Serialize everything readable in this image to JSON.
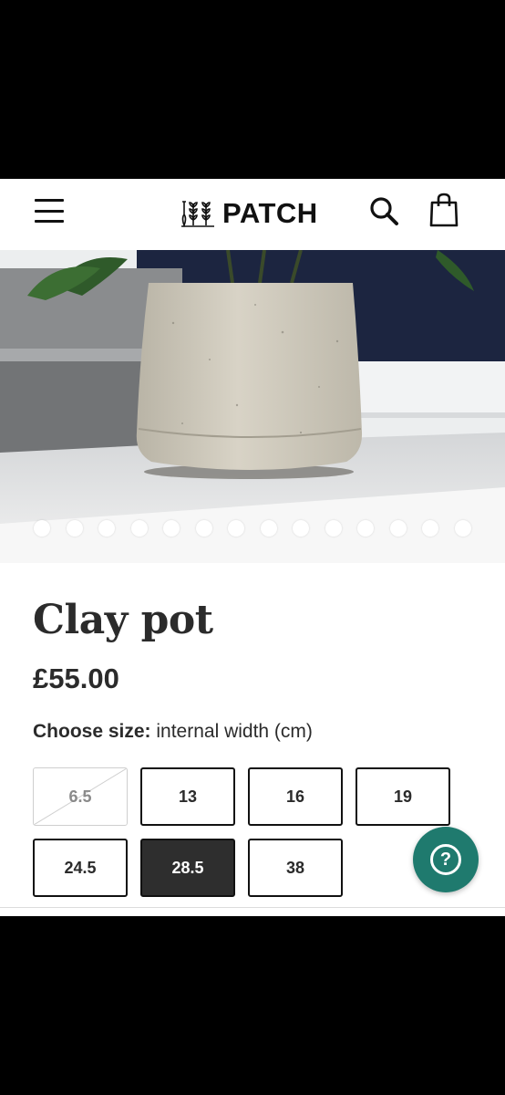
{
  "header": {
    "brand": "PATCH",
    "menu_icon": "hamburger-menu-icon",
    "search_icon": "search-icon",
    "bag_icon": "shopping-bag-icon"
  },
  "gallery": {
    "image": "concrete-plant-pot-photo",
    "slide_count": 14
  },
  "product": {
    "title": "Clay pot",
    "price": "£55.00"
  },
  "size_selector": {
    "label_strong": "Choose size:",
    "label_rest": " internal width (cm)",
    "options": [
      {
        "label": "6.5",
        "state": "unavailable"
      },
      {
        "label": "13",
        "state": "available"
      },
      {
        "label": "16",
        "state": "available"
      },
      {
        "label": "19",
        "state": "available"
      },
      {
        "label": "24.5",
        "state": "available"
      },
      {
        "label": "28.5",
        "state": "selected"
      },
      {
        "label": "38",
        "state": "available"
      }
    ]
  },
  "help": {
    "icon": "question-mark-icon",
    "symbol": "?"
  },
  "colors": {
    "accent": "#1f7a6e",
    "text": "#2b2b2b",
    "selected": "#2e2e2e"
  }
}
